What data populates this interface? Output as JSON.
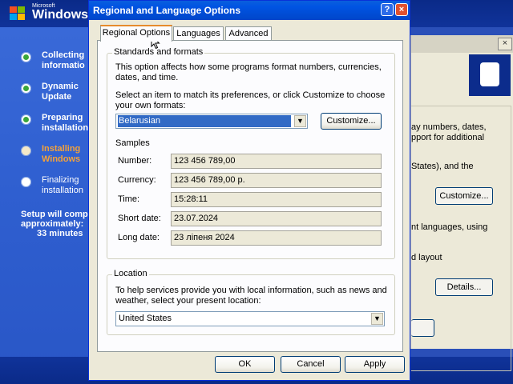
{
  "setup": {
    "logo_small": "Microsoft",
    "logo": "Windows",
    "steps": [
      {
        "label": "Collecting\ninformatio",
        "state": "done"
      },
      {
        "label": "Dynamic\nUpdate",
        "state": "done"
      },
      {
        "label": "Preparing\ninstallation",
        "state": "done"
      },
      {
        "label": "Installing\nWindows",
        "state": "active"
      },
      {
        "label": "Finalizing\ninstallation",
        "state": "pending"
      }
    ],
    "eta_line1": "Setup will comp",
    "eta_line2": "approximately:",
    "eta_line3": "33 minutes"
  },
  "background_dialog": {
    "close_glyph": "×",
    "text1": "ay numbers, dates,",
    "text2": "pport for additional",
    "text3": "States), and the",
    "customize_label": "Customize...",
    "text4": "nt languages, using",
    "text5": "d layout",
    "details_label": "Details..."
  },
  "dialog": {
    "title": "Regional and Language Options",
    "help_glyph": "?",
    "close_glyph": "×",
    "tabs": [
      "Regional Options",
      "Languages",
      "Advanced"
    ],
    "standards": {
      "title": "Standards and formats",
      "desc1": "This option affects how some programs format numbers, currencies,",
      "desc2": "dates, and time.",
      "select1": "Select an item to match its preferences, or click Customize to choose",
      "select2": "your own formats:",
      "format_value": "Belarusian",
      "customize_label": "Customize...",
      "samples_label": "Samples",
      "samples": [
        {
          "label": "Number:",
          "value": "123 456 789,00"
        },
        {
          "label": "Currency:",
          "value": "123 456 789,00 р."
        },
        {
          "label": "Time:",
          "value": "15:28:11"
        },
        {
          "label": "Short date:",
          "value": "23.07.2024"
        },
        {
          "label": "Long date:",
          "value": "23 ліпеня 2024"
        }
      ]
    },
    "location": {
      "title": "Location",
      "desc1": "To help services provide you with local information, such as news and",
      "desc2": "weather, select your present location:",
      "value": "United States"
    },
    "ok_label": "OK",
    "cancel_label": "Cancel",
    "apply_label": "Apply"
  },
  "colors": {
    "title_blue": "#0054e3",
    "dialog_bg": "#ece9d8",
    "selection": "#316ac5",
    "tab_accent": "#e68b2c",
    "active_step": "#f5a23a"
  }
}
